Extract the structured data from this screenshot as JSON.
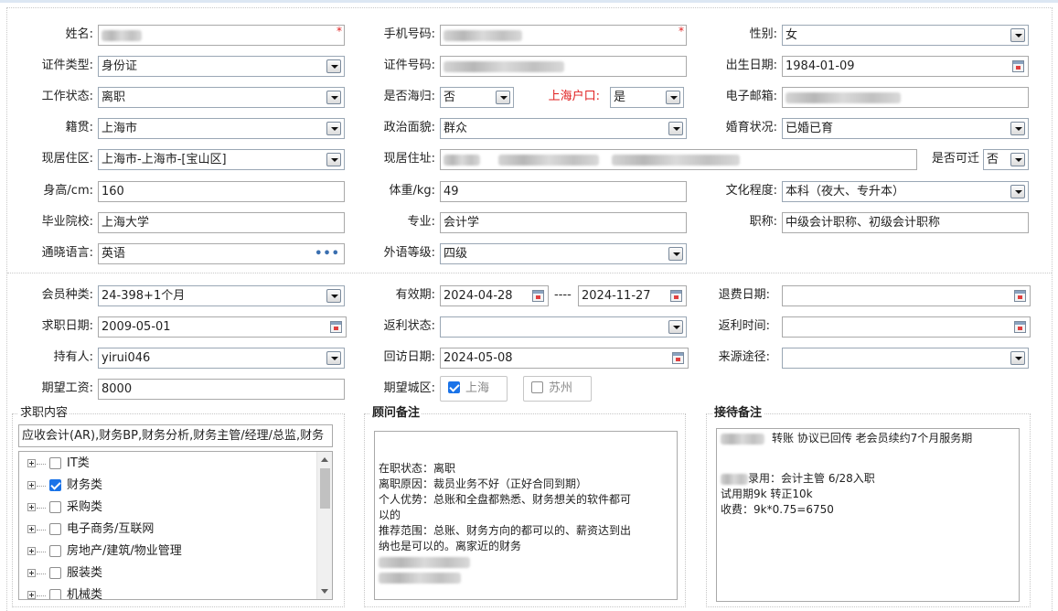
{
  "personal": {
    "name_label": "姓名:",
    "phone_label": "手机号码:",
    "gender_label": "性别:",
    "gender_value": "女",
    "id_type_label": "证件类型:",
    "id_type_value": "身份证",
    "id_number_label": "证件号码:",
    "birth_label": "出生日期:",
    "birth_value": "1984-01-09",
    "work_status_label": "工作状态:",
    "work_status_value": "离职",
    "returnee_label": "是否海归:",
    "returnee_value": "否",
    "shanghai_hukou_label": "上海户口:",
    "shanghai_hukou_value": "是",
    "email_label": "电子邮箱:",
    "native_place_label": "籍贯:",
    "native_place_value": "上海市",
    "political_label": "政治面貌:",
    "political_value": "群众",
    "marital_label": "婚育状况:",
    "marital_value": "已婚已育",
    "residence_area_label": "现居住区:",
    "residence_area_value": "上海市-上海市-[宝山区]",
    "address_label": "现居住址:",
    "relocate_label": "是否可迁",
    "relocate_value": "否",
    "height_label": "身高/cm:",
    "height_value": "160",
    "weight_label": "体重/kg:",
    "weight_value": "49",
    "education_label": "文化程度:",
    "education_value": "本科（夜大、专升本）",
    "school_label": "毕业院校:",
    "school_value": "上海大学",
    "major_label": "专业:",
    "major_value": "会计学",
    "title_label": "职称:",
    "title_value": "中级会计职称、初级会计职称",
    "language_label": "通晓语言:",
    "language_value": "英语",
    "language_level_label": "外语等级:",
    "language_level_value": "四级"
  },
  "membership": {
    "member_type_label": "会员种类:",
    "member_type_value": "24-398+1个月",
    "valid_label": "有效期:",
    "valid_from": "2024-04-28",
    "valid_sep": "----",
    "valid_to": "2024-11-27",
    "refund_date_label": "退费日期:",
    "refund_date_value": "",
    "job_date_label": "求职日期:",
    "job_date_value": "2009-05-01",
    "rebate_status_label": "返利状态:",
    "rebate_status_value": "",
    "rebate_time_label": "返利时间:",
    "rebate_time_value": "",
    "holder_label": "持有人:",
    "holder_value": "yirui046",
    "visit_date_label": "回访日期:",
    "visit_date_value": "2024-05-08",
    "source_label": "来源途径:",
    "source_value": "",
    "salary_label": "期望工资:",
    "salary_value": "8000",
    "city_label": "期望城区:",
    "cities": [
      {
        "label": "上海",
        "checked": true
      },
      {
        "label": "苏州",
        "checked": false
      }
    ]
  },
  "job_content": {
    "legend": "求职内容",
    "summary": "应收会计(AR),财务BP,财务分析,财务主管/经理/总监,财务",
    "categories": [
      {
        "label": "IT类",
        "checked": false
      },
      {
        "label": "财务类",
        "checked": true
      },
      {
        "label": "采购类",
        "checked": false
      },
      {
        "label": "电子商务/互联网",
        "checked": false
      },
      {
        "label": "房地产/建筑/物业管理",
        "checked": false
      },
      {
        "label": "服装类",
        "checked": false
      },
      {
        "label": "机械类",
        "checked": false
      }
    ]
  },
  "advisor_notes": {
    "legend": "顾问备注",
    "lines": [
      "在职状态：离职",
      "离职原因：裁员业务不好（正好合同到期）",
      "个人优势：总账和全盘都熟悉、财务想关的软件都可",
      "以的",
      "推荐范围：总账、财务方向的都可以的、薪资达到出",
      "纳也是可以的。离家近的财务"
    ]
  },
  "reception_notes": {
    "legend": "接待备注",
    "line1": "转账 协议已回传  老会员续约7个月服务期",
    "line2": "录用：会计主管  6/28入职",
    "line3": "试用期9k 转正10k",
    "line4": "收费：9k*0.75=6750"
  },
  "icons": {
    "dropdown": "chevron-down-icon",
    "calendar": "calendar-icon",
    "more": "more-icon",
    "required": "required-asterisk",
    "checkbox": "checkbox-icon",
    "expander": "plus-expander-icon"
  }
}
